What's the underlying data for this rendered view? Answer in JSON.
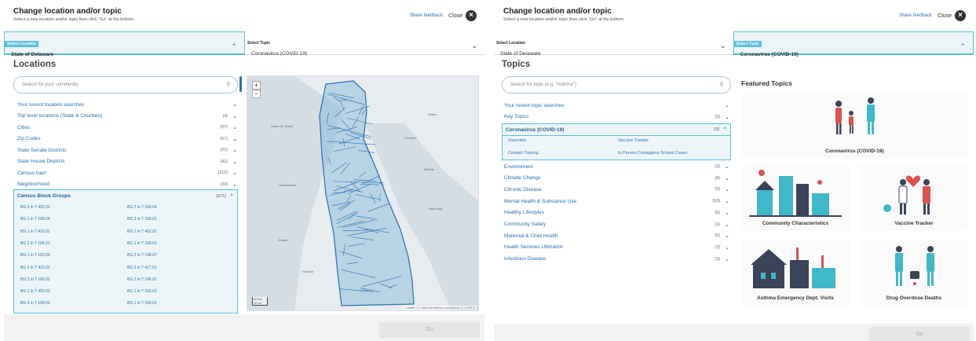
{
  "left": {
    "header": {
      "title": "Change location and/or topic",
      "subtitle": "Select a new location and/or topic then click \"Go\" at the bottom.",
      "feedback": "Share feedback",
      "close": "Close"
    },
    "tabs": {
      "location_label": "Select Location",
      "location_value": "State of Delaware",
      "topic_label": "Select Topic",
      "topic_value": "Coronavirus (COVID-19)"
    },
    "section_title": "Locations",
    "search_placeholder": "Search for your community",
    "rows": [
      {
        "label": "Your recent location searches",
        "count": ""
      },
      {
        "label": "Top level locations (State & Counties)",
        "count": "(4)"
      },
      {
        "label": "Cities",
        "count": "(57)"
      },
      {
        "label": "Zip Codes",
        "count": "(67)"
      },
      {
        "label": "State Senate Districts",
        "count": "(21)"
      },
      {
        "label": "State House Districts",
        "count": "(41)"
      },
      {
        "label": "Census tract",
        "count": "(215)"
      },
      {
        "label": "Neighborhood",
        "count": "(34)"
      }
    ],
    "group": {
      "label": "Census Block Groups",
      "count": "(571)"
    },
    "block_groups": [
      [
        "BG 2 in T 402.02",
        "BG 2 in T 166.04"
      ],
      [
        "BG 1 in T 168.04",
        "BG 3 in T 166.01"
      ],
      [
        "BG 1 in T 422.01",
        "BG 1 in T 402.02"
      ],
      [
        "BG 2 in T 164.01",
        "BG 1 in T 168.01"
      ],
      [
        "BG 1 in T 163.05",
        "BG 2 in T 148.07"
      ],
      [
        "BG 2 in T 422.02",
        "BG 2 in T 417.01"
      ],
      [
        "BG 2 in T 166.02",
        "BG 2 in T 145.02"
      ],
      [
        "BG 1 in T 402.03",
        "BG 1 in T 166.02"
      ],
      [
        "BG 4 in T 149.03",
        "BG 1 in T 166.01"
      ]
    ],
    "map": {
      "zoom_in": "+",
      "zoom_out": "−",
      "scale_km": "20 km",
      "scale_mi": "10 mi",
      "attribution": "Leaflet | © OpenStreetMap contributors © CARTO",
      "land_color": "#e8ecee",
      "water_color": "#d4dde3",
      "state_fill": "#7fb6d6",
      "state_stroke": "#2a6fb0"
    },
    "go": "Go"
  },
  "right": {
    "header": {
      "title": "Change location and/or topic",
      "subtitle": "Select a new location and/or topic then click \"Go\" at the bottom.",
      "feedback": "Share feedback",
      "close": "Close"
    },
    "tabs": {
      "location_label": "Select Location",
      "location_value": "State of Delaware",
      "topic_label": "Select Topic",
      "topic_value": "Coronavirus (COVID-19)"
    },
    "section_title": "Topics",
    "search_placeholder": "Search for topic (e.g. \"Asthma\")",
    "rows_top": [
      {
        "label": "Your recent topic searches",
        "count": ""
      },
      {
        "label": "Key Topics",
        "count": "(2)"
      }
    ],
    "group": {
      "label": "Coronavirus (COVID-19)",
      "count": "(3)"
    },
    "group_items": [
      "Overview",
      "Vaccine Tracker",
      "Contact Tracing",
      "In Person Contagious School Cases"
    ],
    "rows_bottom": [
      {
        "label": "Environment",
        "count": "(3)"
      },
      {
        "label": "Climate Change",
        "count": "(8)"
      },
      {
        "label": "Chronic Disease",
        "count": "(5)"
      },
      {
        "label": "Mental Health & Substance Use",
        "count": "(10)"
      },
      {
        "label": "Healthy Lifestyles",
        "count": "(5)"
      },
      {
        "label": "Community Safety",
        "count": "(1)"
      },
      {
        "label": "Maternal & Child Health",
        "count": "(5)"
      },
      {
        "label": "Health Services Utilization",
        "count": "(2)"
      },
      {
        "label": "Infectious Disease",
        "count": "(3)"
      }
    ],
    "featured_title": "Featured Topics",
    "featured": [
      "Coronavirus (COVID-19)",
      "Community Characteristics",
      "Vaccine Tracker",
      "Asthma Emergency Dept. Visits",
      "Drug Overdose Deaths"
    ],
    "go": "Go",
    "accent": "#5bc0de",
    "illustration_teal": "#3fb8c9",
    "illustration_dark": "#3a4358",
    "illustration_red": "#d9534f"
  }
}
